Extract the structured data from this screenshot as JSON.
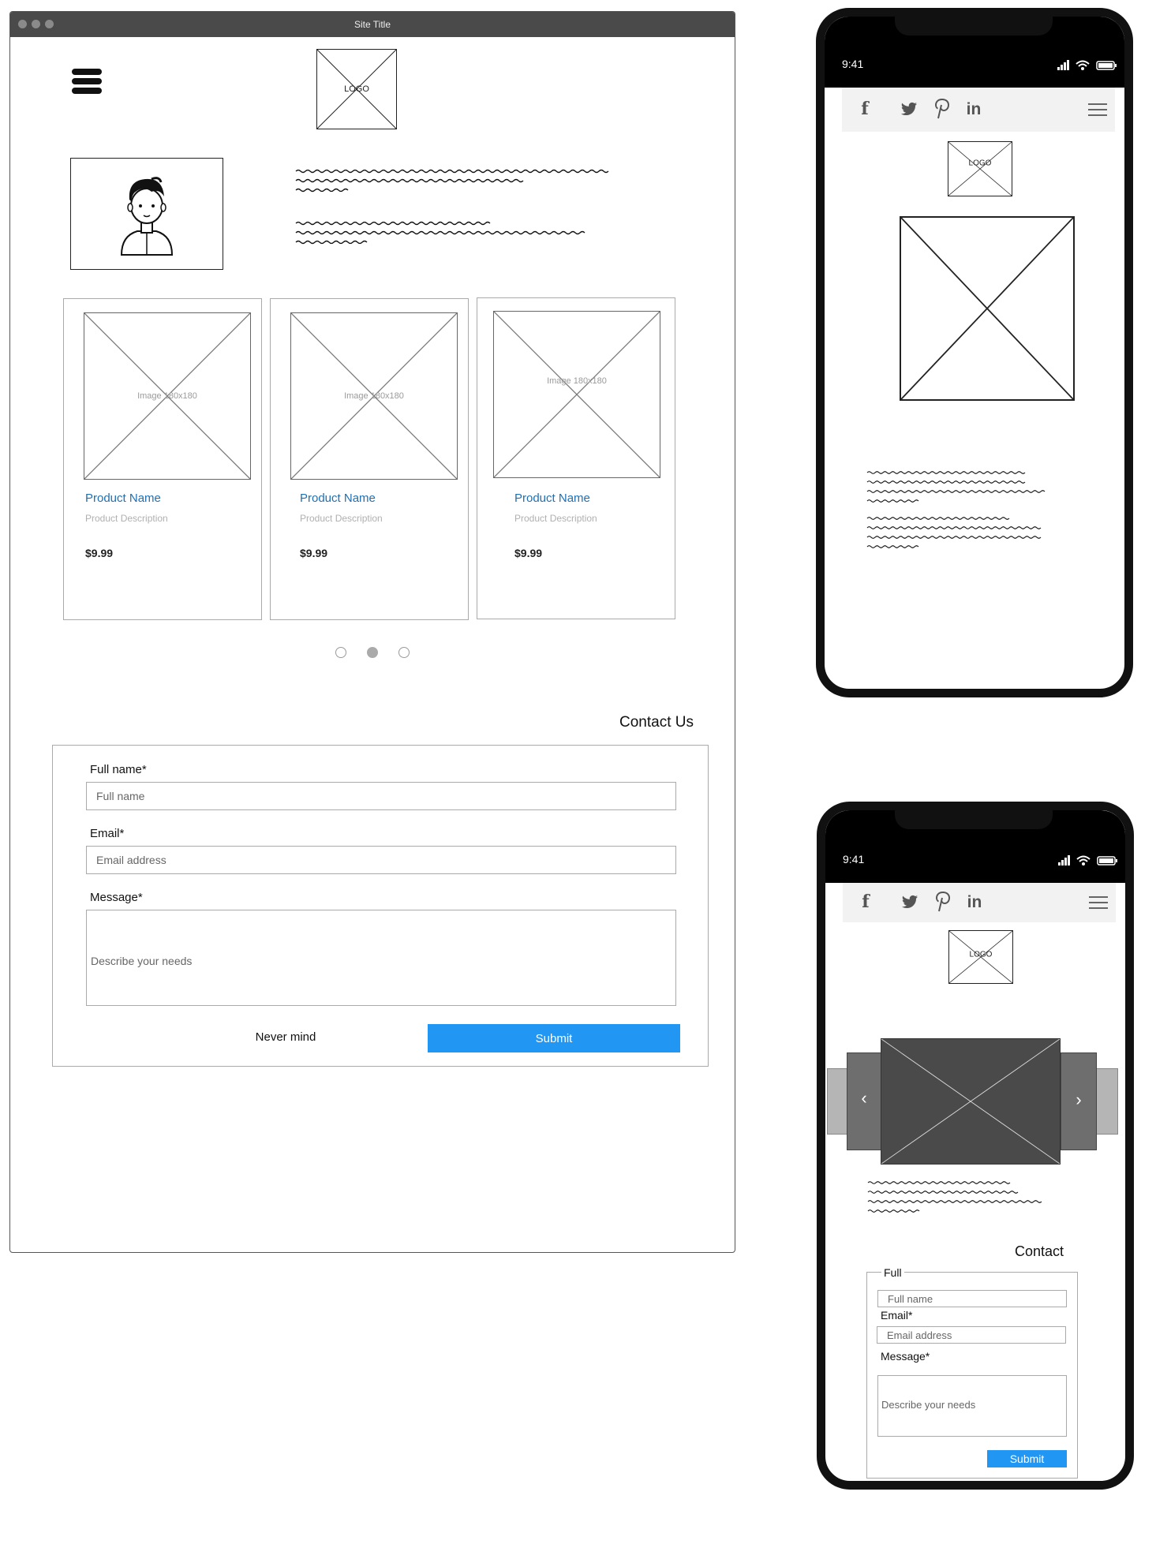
{
  "browser": {
    "site_title": "Site Title",
    "logo_label": "LOGO",
    "products": [
      {
        "image_label": "Image 180x180",
        "name": "Product Name",
        "description": "Product Description",
        "price": "$9.99"
      },
      {
        "image_label": "Image 180x180",
        "name": "Product Name",
        "description": "Product Description",
        "price": "$9.99"
      },
      {
        "image_label": "Image 180x180",
        "name": "Product Name",
        "description": "Product Description",
        "price": "$9.99"
      }
    ],
    "pagination": {
      "count": 3,
      "active": 2
    },
    "contact": {
      "heading": "Contact Us",
      "fullname_label": "Full name*",
      "fullname_placeholder": "Full name",
      "email_label": "Email*",
      "email_placeholder": "Email address",
      "message_label": "Message*",
      "message_placeholder": "Describe your needs",
      "cancel_label": "Never mind",
      "submit_label": "Submit"
    }
  },
  "phone1": {
    "time": "9:41",
    "logo_label": "LOGO",
    "social_icons": [
      "facebook-icon",
      "twitter-icon",
      "pinterest-icon",
      "linkedin-icon"
    ]
  },
  "phone2": {
    "time": "9:41",
    "logo_label": "LOGO",
    "social_icons": [
      "facebook-icon",
      "twitter-icon",
      "pinterest-icon",
      "linkedin-icon"
    ],
    "contact": {
      "heading": "Contact",
      "fullname_label": "Full",
      "fullname_placeholder": "Full name",
      "email_label": "Email*",
      "email_placeholder": "Email address",
      "message_label": "Message*",
      "message_placeholder": "Describe your needs",
      "submit_label": "Submit"
    }
  },
  "colors": {
    "accent": "#2196f3",
    "link": "#1f6fb5",
    "chrome": "#4a4a4a"
  }
}
